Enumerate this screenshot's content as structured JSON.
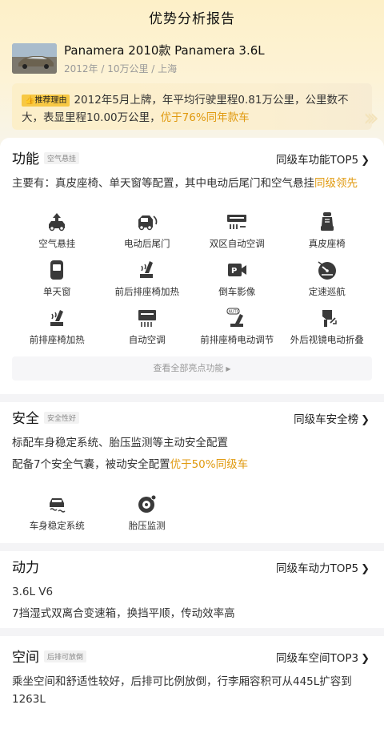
{
  "header": {
    "title": "优势分析报告"
  },
  "car": {
    "name": "Panamera 2010款 Panamera 3.6L",
    "meta": "2012年 / 10万公里 / 上海"
  },
  "reason": {
    "badge": "推荐理由",
    "text": "2012年5月上牌，年平均行驶里程0.81万公里，公里数不大，表显里程10.00万公里，",
    "highlight": "优于76%同年款车"
  },
  "features": {
    "title": "功能",
    "tag": "空气悬挂",
    "link": "同级车功能TOP5",
    "desc_prefix": "主要有：真皮座椅、单天窗等配置，其中电动后尾门和空气悬挂",
    "desc_highlight": "同级领先",
    "items": [
      {
        "label": "空气悬挂",
        "icon": "air-suspension-icon"
      },
      {
        "label": "电动后尾门",
        "icon": "power-tailgate-icon"
      },
      {
        "label": "双区自动空调",
        "icon": "dual-zone-ac-icon"
      },
      {
        "label": "真皮座椅",
        "icon": "leather-seat-icon"
      },
      {
        "label": "单天窗",
        "icon": "sunroof-icon"
      },
      {
        "label": "前后排座椅加热",
        "icon": "seat-heating-icon"
      },
      {
        "label": "倒车影像",
        "icon": "rear-camera-icon"
      },
      {
        "label": "定速巡航",
        "icon": "cruise-control-icon"
      },
      {
        "label": "前排座椅加热",
        "icon": "front-seat-heating-icon"
      },
      {
        "label": "自动空调",
        "icon": "auto-ac-icon"
      },
      {
        "label": "前排座椅电动调节",
        "icon": "power-seat-adjust-icon"
      },
      {
        "label": "外后视镜电动折叠",
        "icon": "mirror-fold-icon"
      }
    ],
    "more": "查看全部亮点功能"
  },
  "safety": {
    "title": "安全",
    "tag": "安全性好",
    "link": "同级车安全榜",
    "desc1": "标配车身稳定系统、胎压监测等主动安全配置",
    "desc2_prefix": "配备7个安全气囊，被动安全配置",
    "desc2_highlight": "优于50%同级车",
    "items": [
      {
        "label": "车身稳定系统",
        "icon": "stability-control-icon"
      },
      {
        "label": "胎压监测",
        "icon": "tire-pressure-icon"
      }
    ]
  },
  "power": {
    "title": "动力",
    "link": "同级车动力TOP5",
    "engine": "3.6L V6",
    "gearbox": "7挡湿式双离合变速箱，换挡平顺，传动效率高"
  },
  "space": {
    "title": "空间",
    "tag": "后排可放倒",
    "link": "同级车空间TOP3",
    "desc": "乘坐空间和舒适性较好，后排可比例放倒，行李厢容积可从445L扩容到1263L"
  },
  "colors": {
    "accent": "#e09a10",
    "badge": "#f7c844",
    "icon": "#3a3a3a"
  }
}
